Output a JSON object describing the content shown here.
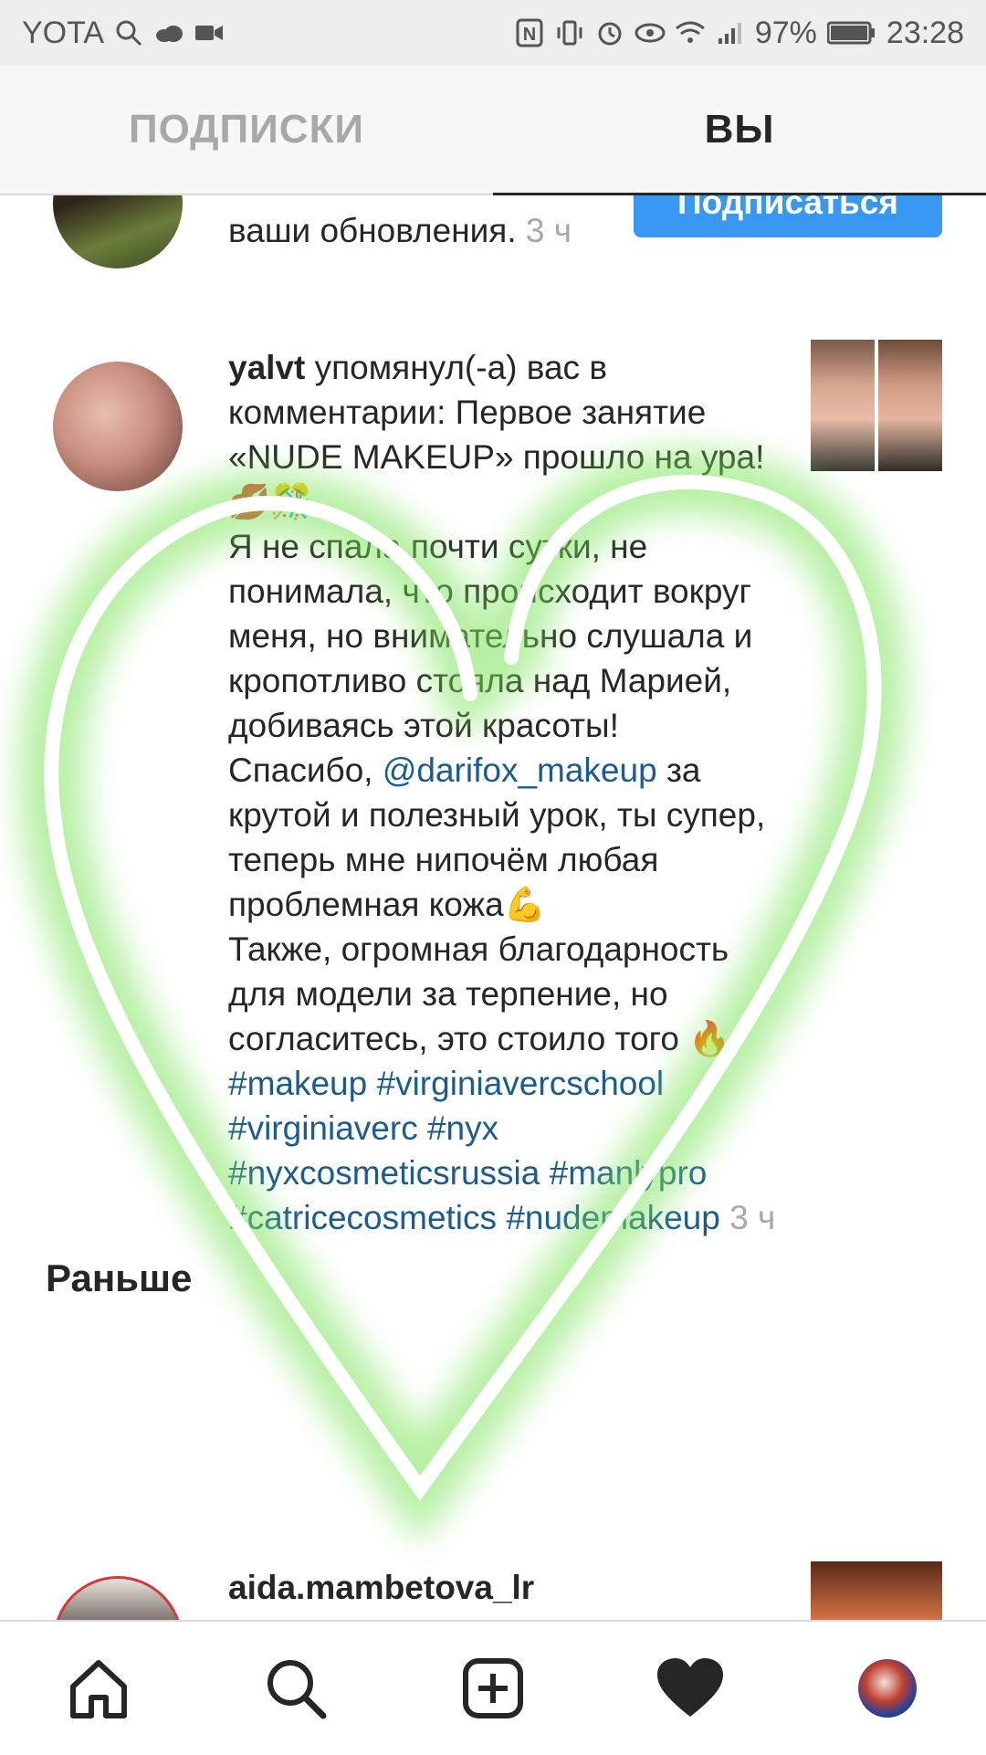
{
  "status_bar": {
    "carrier": "YOTA",
    "battery": "97%",
    "time": "23:28"
  },
  "tabs": [
    {
      "label": "ПОДПИСКИ"
    },
    {
      "label": "ВЫ"
    }
  ],
  "notifications": [
    {
      "text_tail": "ваши обновления.",
      "time": "3 ч",
      "follow_label": "Подписаться"
    },
    {
      "username": "yalvt",
      "action": "упомянул(-а) вас в комментарии:",
      "comment_part1": "Первое занятие «NUDE MAKEUP» прошло на ура!💋🎊",
      "comment_part2": "Я не спала почти сутки, не понимала, что происходит вокруг меня, но внимательно слушала и кропотливо стояла над Марией, добиваясь этой красоты!",
      "comment_part3_prefix": "Спасибо,",
      "mention": "@darifox_makeup",
      "comment_part3_suffix": "за крутой и полезный урок, ты супер, теперь мне нипочём любая проблемная кожа💪",
      "comment_part4": "Также, огромная благодарность для модели за терпение, но согласитесь, это стоило того 🔥",
      "hashtags": [
        "#makeup",
        "#virginiavercschool",
        "#virginiaverc",
        "#nyx",
        "#nyxcosmeticsrussia",
        "#manlypro",
        "#catricecosmetics",
        "#nudemakeup"
      ],
      "time": "3 ч"
    }
  ],
  "section_earlier": "Раньше",
  "earlier_item": {
    "username": "aida.mambetova_lr"
  },
  "bottom_nav": [
    "home-icon",
    "search-icon",
    "add-post-icon",
    "activity-heart-icon",
    "profile-avatar-icon"
  ],
  "colors": {
    "accent": "#3897f0",
    "link": "#1b5b8f",
    "overlay_glow": "#7de35a"
  }
}
